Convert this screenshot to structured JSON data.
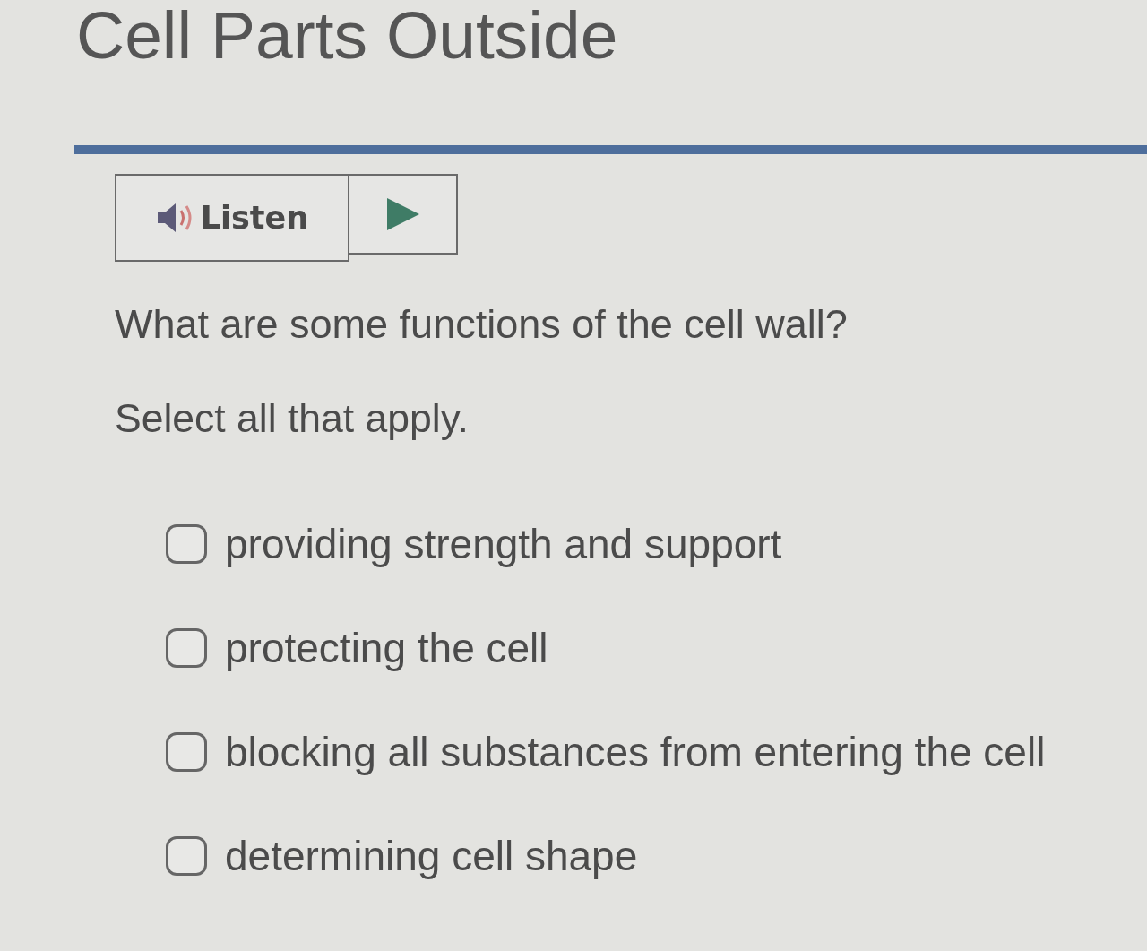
{
  "page": {
    "title": "Cell Parts Outside"
  },
  "audio": {
    "listen_label": "Listen"
  },
  "question": {
    "prompt": "What are some functions of the cell wall?",
    "instruction": "Select all that apply.",
    "options": [
      {
        "label": "providing strength and support",
        "checked": false
      },
      {
        "label": "protecting the cell",
        "checked": false
      },
      {
        "label": "blocking all substances from entering the cell",
        "checked": false
      },
      {
        "label": "determining cell shape",
        "checked": false
      }
    ]
  }
}
